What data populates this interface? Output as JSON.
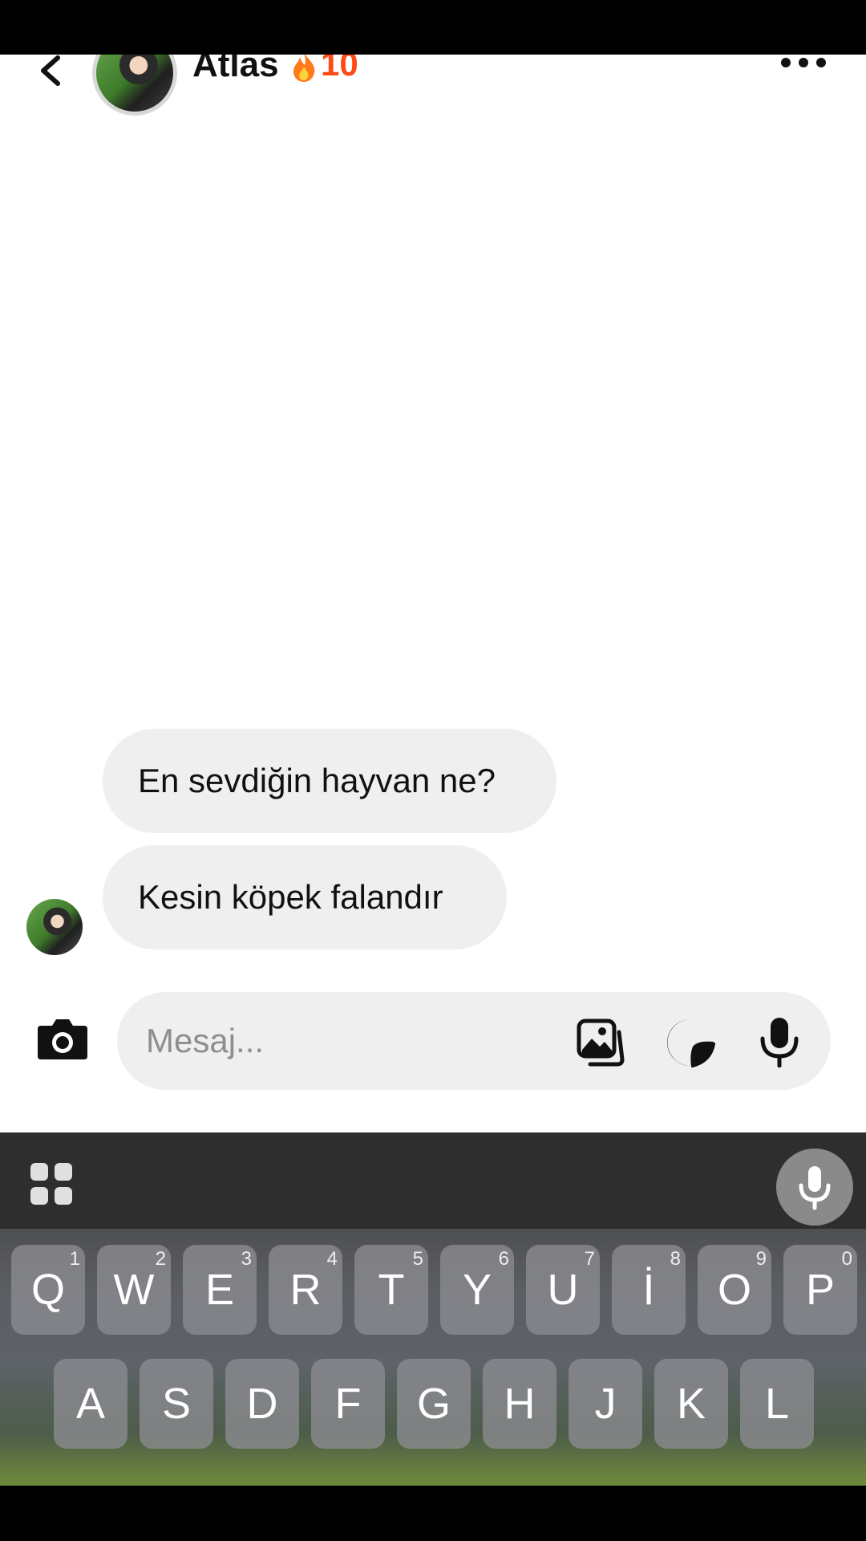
{
  "header": {
    "back_icon": "chevron-left-icon",
    "title": "Atlas",
    "streak_icon": "fire-icon",
    "streak_count": "10",
    "more_icon": "more-horizontal-icon"
  },
  "messages": [
    {
      "text": "En sevdiğin hayvan ne?"
    },
    {
      "text": "Kesin köpek falandır"
    }
  ],
  "composer": {
    "placeholder": "Mesaj...",
    "camera_icon": "camera-icon",
    "gallery_icon": "gallery-icon",
    "sticker_icon": "sticker-icon",
    "mic_icon": "microphone-icon"
  },
  "keyboard": {
    "row1": [
      {
        "key": "Q",
        "sub": "1"
      },
      {
        "key": "W",
        "sub": "2"
      },
      {
        "key": "E",
        "sub": "3"
      },
      {
        "key": "R",
        "sub": "4"
      },
      {
        "key": "T",
        "sub": "5"
      },
      {
        "key": "Y",
        "sub": "6"
      },
      {
        "key": "U",
        "sub": "7"
      },
      {
        "key": "İ",
        "sub": "8"
      },
      {
        "key": "O",
        "sub": "9"
      },
      {
        "key": "P",
        "sub": "0"
      }
    ],
    "row2": [
      "A",
      "S",
      "D",
      "F",
      "G",
      "H",
      "J",
      "K",
      "L"
    ]
  },
  "colors": {
    "streak": "#ff4a17",
    "bubble": "#efefef"
  }
}
